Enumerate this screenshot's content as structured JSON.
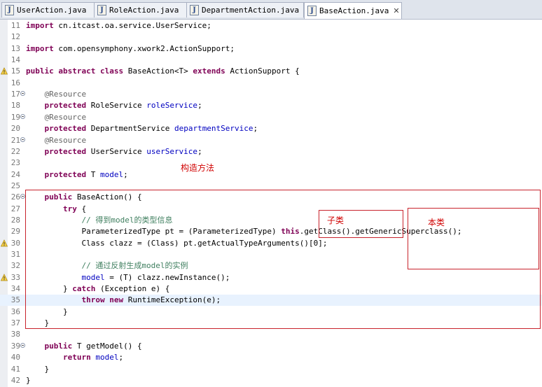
{
  "tabs": [
    {
      "label": "UserAction.java",
      "active": false
    },
    {
      "label": "RoleAction.java",
      "active": false
    },
    {
      "label": "DepartmentAction.java",
      "active": false
    },
    {
      "label": "BaseAction.java",
      "active": true
    }
  ],
  "tab_close_glyph": "✕",
  "lines": [
    {
      "n": "11",
      "fold": false,
      "warn": false,
      "hl": false,
      "tokens": [
        [
          "kw",
          "import"
        ],
        [
          "p",
          " cn.itcast.oa.service.UserService;"
        ]
      ]
    },
    {
      "n": "12",
      "fold": false,
      "warn": false,
      "hl": false,
      "tokens": []
    },
    {
      "n": "13",
      "fold": false,
      "warn": false,
      "hl": false,
      "tokens": [
        [
          "kw",
          "import"
        ],
        [
          "p",
          " com.opensymphony.xwork2.ActionSupport;"
        ]
      ]
    },
    {
      "n": "14",
      "fold": false,
      "warn": false,
      "hl": false,
      "tokens": []
    },
    {
      "n": "15",
      "fold": false,
      "warn": true,
      "hl": false,
      "tokens": [
        [
          "kw",
          "public abstract class"
        ],
        [
          "p",
          " BaseAction<T> "
        ],
        [
          "kw",
          "extends"
        ],
        [
          "p",
          " ActionSupport {"
        ]
      ]
    },
    {
      "n": "16",
      "fold": false,
      "warn": false,
      "hl": false,
      "tokens": []
    },
    {
      "n": "17",
      "fold": true,
      "warn": false,
      "hl": false,
      "tokens": [
        [
          "p",
          "    "
        ],
        [
          "ann",
          "@Resource"
        ]
      ]
    },
    {
      "n": "18",
      "fold": false,
      "warn": false,
      "hl": false,
      "tokens": [
        [
          "p",
          "    "
        ],
        [
          "kw",
          "protected"
        ],
        [
          "p",
          " RoleService "
        ],
        [
          "fld",
          "roleService"
        ],
        [
          "p",
          ";"
        ]
      ]
    },
    {
      "n": "19",
      "fold": true,
      "warn": false,
      "hl": false,
      "tokens": [
        [
          "p",
          "    "
        ],
        [
          "ann",
          "@Resource"
        ]
      ]
    },
    {
      "n": "20",
      "fold": false,
      "warn": false,
      "hl": false,
      "tokens": [
        [
          "p",
          "    "
        ],
        [
          "kw",
          "protected"
        ],
        [
          "p",
          " DepartmentService "
        ],
        [
          "fld",
          "departmentService"
        ],
        [
          "p",
          ";"
        ]
      ]
    },
    {
      "n": "21",
      "fold": true,
      "warn": false,
      "hl": false,
      "tokens": [
        [
          "p",
          "    "
        ],
        [
          "ann",
          "@Resource"
        ]
      ]
    },
    {
      "n": "22",
      "fold": false,
      "warn": false,
      "hl": false,
      "tokens": [
        [
          "p",
          "    "
        ],
        [
          "kw",
          "protected"
        ],
        [
          "p",
          " UserService "
        ],
        [
          "fld",
          "userService"
        ],
        [
          "p",
          ";"
        ]
      ]
    },
    {
      "n": "23",
      "fold": false,
      "warn": false,
      "hl": false,
      "tokens": []
    },
    {
      "n": "24",
      "fold": false,
      "warn": false,
      "hl": false,
      "tokens": [
        [
          "p",
          "    "
        ],
        [
          "kw",
          "protected"
        ],
        [
          "p",
          " T "
        ],
        [
          "fld",
          "model"
        ],
        [
          "p",
          ";"
        ]
      ]
    },
    {
      "n": "25",
      "fold": false,
      "warn": false,
      "hl": false,
      "tokens": []
    },
    {
      "n": "26",
      "fold": true,
      "warn": false,
      "hl": false,
      "tokens": [
        [
          "p",
          "    "
        ],
        [
          "kw",
          "public"
        ],
        [
          "p",
          " BaseAction() {"
        ]
      ]
    },
    {
      "n": "27",
      "fold": false,
      "warn": false,
      "hl": false,
      "tokens": [
        [
          "p",
          "        "
        ],
        [
          "kw",
          "try"
        ],
        [
          "p",
          " {"
        ]
      ]
    },
    {
      "n": "28",
      "fold": false,
      "warn": false,
      "hl": false,
      "tokens": [
        [
          "p",
          "            "
        ],
        [
          "cmt",
          "// 得到model的类型信息"
        ]
      ]
    },
    {
      "n": "29",
      "fold": false,
      "warn": false,
      "hl": false,
      "tokens": [
        [
          "p",
          "            ParameterizedType pt = (ParameterizedType) "
        ],
        [
          "kw",
          "this"
        ],
        [
          "p",
          ".getClass().getGenericSuperclass();"
        ]
      ]
    },
    {
      "n": "30",
      "fold": false,
      "warn": true,
      "hl": false,
      "tokens": [
        [
          "p",
          "            Class clazz = (Class) pt.getActualTypeArguments()[0];"
        ]
      ]
    },
    {
      "n": "31",
      "fold": false,
      "warn": false,
      "hl": false,
      "tokens": []
    },
    {
      "n": "32",
      "fold": false,
      "warn": false,
      "hl": false,
      "tokens": [
        [
          "p",
          "            "
        ],
        [
          "cmt",
          "// 通过反射生成model的实例"
        ]
      ]
    },
    {
      "n": "33",
      "fold": false,
      "warn": true,
      "hl": false,
      "tokens": [
        [
          "p",
          "            "
        ],
        [
          "fld",
          "model"
        ],
        [
          "p",
          " = (T) clazz.newInstance();"
        ]
      ]
    },
    {
      "n": "34",
      "fold": false,
      "warn": false,
      "hl": false,
      "tokens": [
        [
          "p",
          "        } "
        ],
        [
          "kw",
          "catch"
        ],
        [
          "p",
          " (Exception e) {"
        ]
      ]
    },
    {
      "n": "35",
      "fold": false,
      "warn": false,
      "hl": true,
      "tokens": [
        [
          "p",
          "            "
        ],
        [
          "kw",
          "throw new"
        ],
        [
          "p",
          " RuntimeException(e);"
        ]
      ]
    },
    {
      "n": "36",
      "fold": false,
      "warn": false,
      "hl": false,
      "tokens": [
        [
          "p",
          "        }"
        ]
      ]
    },
    {
      "n": "37",
      "fold": false,
      "warn": false,
      "hl": false,
      "tokens": [
        [
          "p",
          "    }"
        ]
      ]
    },
    {
      "n": "38",
      "fold": false,
      "warn": false,
      "hl": false,
      "tokens": []
    },
    {
      "n": "39",
      "fold": true,
      "warn": false,
      "hl": false,
      "tokens": [
        [
          "p",
          "    "
        ],
        [
          "kw",
          "public"
        ],
        [
          "p",
          " T getModel() {"
        ]
      ]
    },
    {
      "n": "40",
      "fold": false,
      "warn": false,
      "hl": false,
      "tokens": [
        [
          "p",
          "        "
        ],
        [
          "kw",
          "return"
        ],
        [
          "p",
          " "
        ],
        [
          "fld",
          "model"
        ],
        [
          "p",
          ";"
        ]
      ]
    },
    {
      "n": "41",
      "fold": false,
      "warn": false,
      "hl": false,
      "tokens": [
        [
          "p",
          "    }"
        ]
      ]
    },
    {
      "n": "42",
      "fold": false,
      "warn": false,
      "hl": false,
      "tokens": [
        [
          "p",
          "}"
        ]
      ]
    }
  ],
  "annotations": {
    "constructor_label": "构造方法",
    "subclass_label": "子类",
    "this_class_label": "本类"
  },
  "colors": {
    "keyword": "#7f0055",
    "annotation": "#646464",
    "field": "#0000c0",
    "comment": "#3f7f5f",
    "highlight_line": "#e8f2fe",
    "annotation_box": "#c8232c"
  }
}
